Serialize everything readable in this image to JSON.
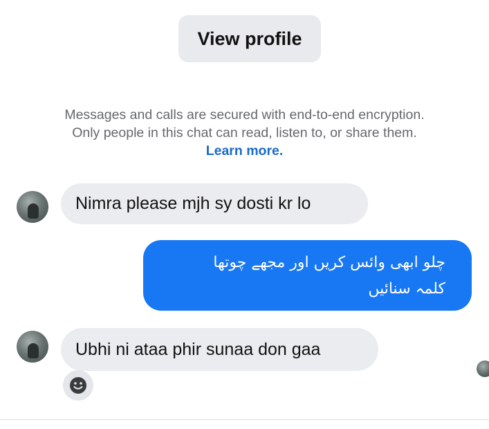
{
  "header": {
    "view_profile_label": "View profile"
  },
  "encryption_notice": {
    "text": "Messages and calls are secured with end-to-end encryption. Only people in this chat can read, listen to, or share them.",
    "link_label": "Learn more."
  },
  "messages": [
    {
      "sender": "other",
      "text": "Nimra please mjh sy dosti kr lo"
    },
    {
      "sender": "me",
      "lines": [
        "چلو ابھی وائس کریں اور مجھے چوتھا",
        "کلمہ سنائیں"
      ]
    },
    {
      "sender": "other",
      "text": "Ubhi ni ataa phir sunaa don gaa"
    }
  ],
  "icons": {
    "reaction": "smiley-face-icon",
    "avatar": "profile-avatar",
    "seen": "seen-avatar"
  }
}
